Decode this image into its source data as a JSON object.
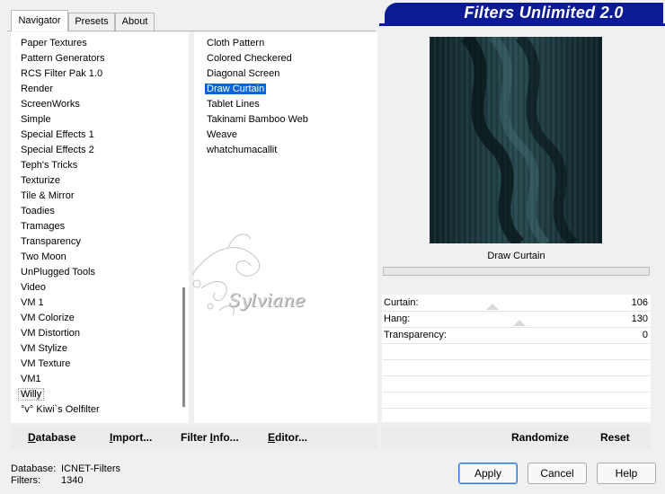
{
  "tabs": [
    {
      "label": "Navigator",
      "active": true
    },
    {
      "label": "Presets",
      "active": false
    },
    {
      "label": "About",
      "active": false
    }
  ],
  "banner": {
    "title": "Filters Unlimited 2.0",
    "color": "#0c1a93"
  },
  "categories": [
    "Paper Textures",
    "Pattern Generators",
    "RCS Filter Pak 1.0",
    "Render",
    "ScreenWorks",
    "Simple",
    "Special Effects 1",
    "Special Effects 2",
    "Teph's Tricks",
    "Texturize",
    "Tile & Mirror",
    "Toadies",
    "Tramages",
    "Transparency",
    "Two Moon",
    "UnPlugged Tools",
    "Video",
    "VM 1",
    "VM Colorize",
    "VM Distortion",
    "VM Stylize",
    "VM Texture",
    "VM1",
    "Willy",
    "°v° Kiwi`s Oelfilter"
  ],
  "categories_focused": "Willy",
  "filters": [
    "Cloth Pattern",
    "Colored Checkered",
    "Diagonal Screen",
    "Draw Curtain",
    "Tablet Lines",
    "Takinami Bamboo Web",
    "Weave",
    "whatchumacallit"
  ],
  "filters_selected": "Draw Curtain",
  "watermark": {
    "text": "Sylviane"
  },
  "preview": {
    "filter_name": "Draw Curtain"
  },
  "params": [
    {
      "label": "Curtain:",
      "value": "106"
    },
    {
      "label": "Hang:",
      "value": "130"
    },
    {
      "label": "Transparency:",
      "value": "0"
    }
  ],
  "toolbar": {
    "database": "Database",
    "import": "Import...",
    "filter_info": "Filter Info...",
    "editor": "Editor...",
    "randomize": "Randomize",
    "reset": "Reset"
  },
  "status": {
    "database_label": "Database:",
    "database_value": "ICNET-Filters",
    "filters_label": "Filters:",
    "filters_value": "1340"
  },
  "buttons": {
    "apply": "Apply",
    "cancel": "Cancel",
    "help": "Help"
  },
  "colors": {
    "selection": "#0a64d6",
    "preview_dark": "#102428",
    "preview_light": "#3d6468"
  }
}
